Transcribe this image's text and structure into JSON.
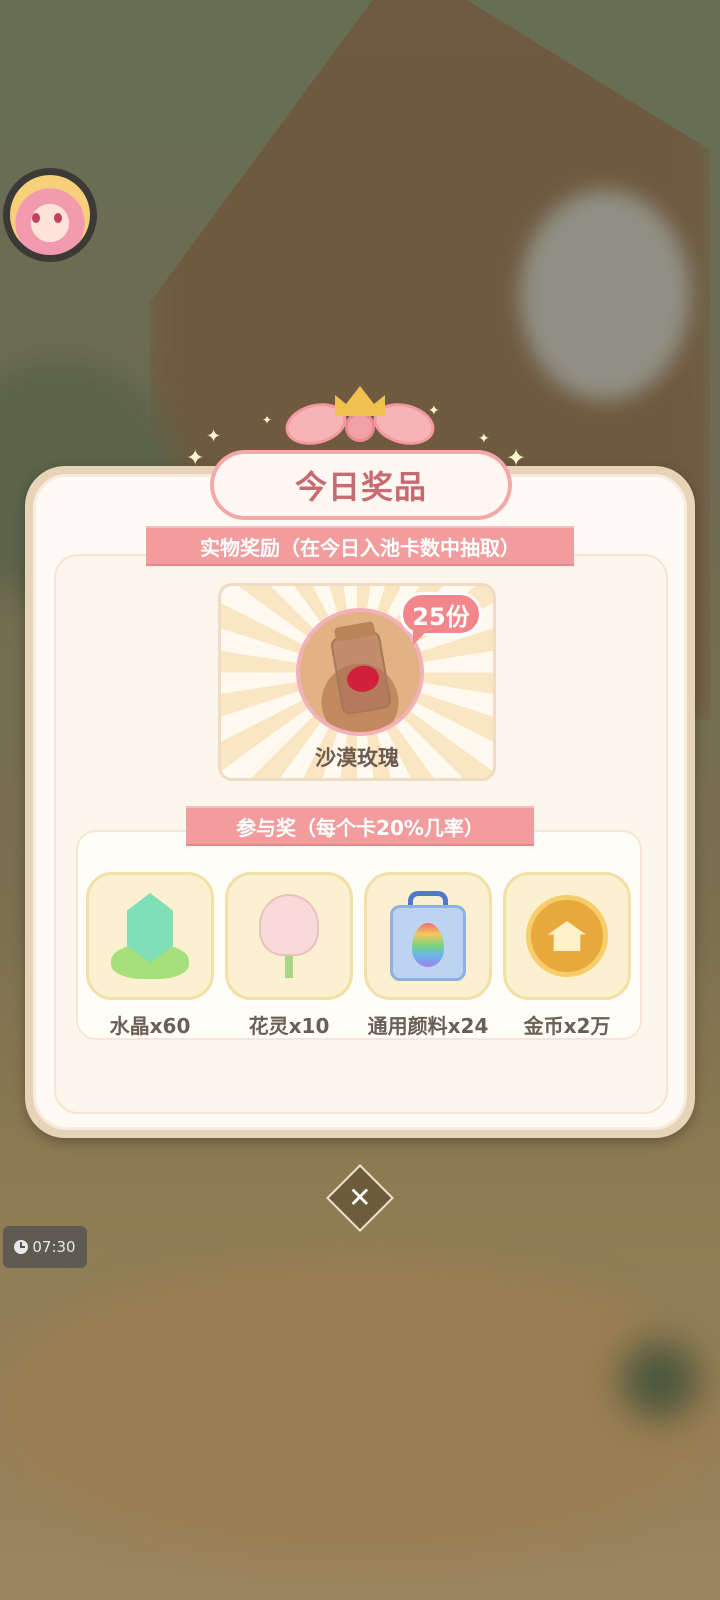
{
  "modal": {
    "title": "今日奖品",
    "physical_section_label": "实物奖励（在今日入池卡数中抽取）",
    "physical_prize": {
      "name": "沙漠玫瑰",
      "count_badge": "25份",
      "icon": "desert-rose-jar"
    },
    "participation_section_label": "参与奖（每个卡20%几率）",
    "participation_items": [
      {
        "label": "水晶x60",
        "icon": "crystal-icon"
      },
      {
        "label": "花灵x10",
        "icon": "flower-spirit-icon"
      },
      {
        "label": "通用颜料x24",
        "icon": "pigment-jar-icon"
      },
      {
        "label": "金币x2万",
        "icon": "gold-coin-icon"
      }
    ],
    "close_icon": "close-icon"
  },
  "hud": {
    "timer_text": "07:30",
    "avatar_icon": "player-avatar"
  },
  "colors": {
    "title_pink": "#c86a72",
    "ribbon_pink": "#f39c9d",
    "badge_pink": "#f2868a",
    "label_brown": "#6a5f55"
  }
}
